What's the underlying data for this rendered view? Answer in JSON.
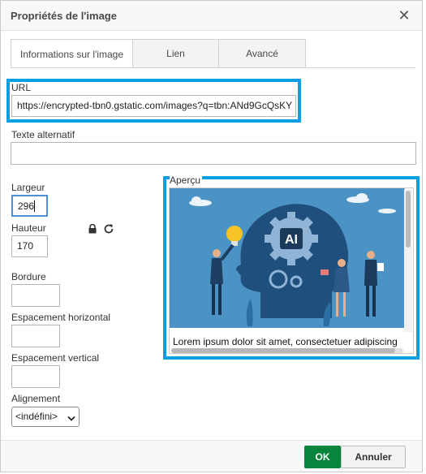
{
  "dialog": {
    "title": "Propriétés de l'image",
    "close_icon": "close-icon"
  },
  "tabs": [
    {
      "label": "Informations sur l'image",
      "active": true
    },
    {
      "label": "Lien",
      "active": false
    },
    {
      "label": "Avancé",
      "active": false
    }
  ],
  "form": {
    "url_label": "URL",
    "url_value": "https://encrypted-tbn0.gstatic.com/images?q=tbn:ANd9GcQsKY",
    "alt_label": "Texte alternatif",
    "alt_value": "",
    "width_label": "Largeur",
    "width_value": "296",
    "height_label": "Hauteur",
    "height_value": "170",
    "lock_icon": "lock-icon",
    "reset_icon": "reset-size-icon",
    "border_label": "Bordure",
    "border_value": "",
    "hspace_label": "Espacement horizontal",
    "hspace_value": "",
    "vspace_label": "Espacement vertical",
    "vspace_value": "",
    "align_label": "Alignement",
    "align_value": "<indéfini>"
  },
  "preview": {
    "label": "Aperçu",
    "image_icon": "ai-head-illustration",
    "image_text": "AI",
    "caption": "Lorem ipsum dolor sit amet, consectetuer adipiscing"
  },
  "footer": {
    "ok_label": "OK",
    "cancel_label": "Annuler"
  },
  "colors": {
    "highlight_border": "#0a9ee3",
    "ok_green": "#09843d",
    "preview_bg": "#4b93c4"
  }
}
